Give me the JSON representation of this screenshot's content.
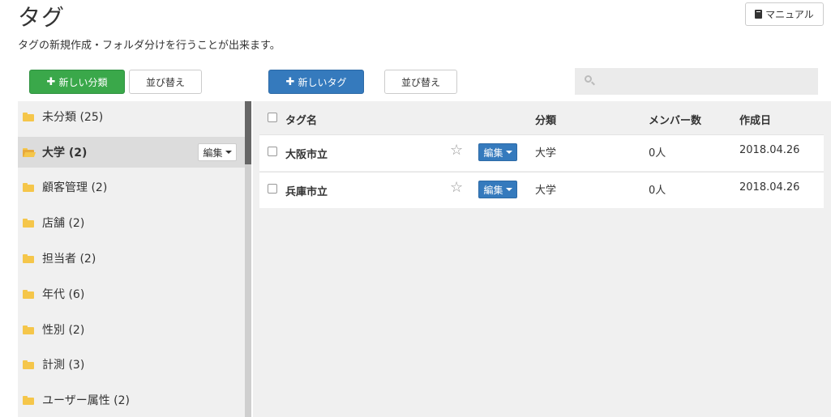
{
  "header": {
    "title": "タグ",
    "description": "タグの新規作成・フォルダ分けを行うことが出来ます。",
    "manual_label": "マニュアル"
  },
  "toolbar": {
    "new_category_label": "新しい分類",
    "sort_left_label": "並び替え",
    "new_tag_label": "新しいタグ",
    "sort_right_label": "並び替え"
  },
  "search": {
    "placeholder": ""
  },
  "sidebar": {
    "items": [
      {
        "label": "未分類 (25)",
        "active": false
      },
      {
        "label": "大学 (2)",
        "active": true
      },
      {
        "label": "顧客管理 (2)",
        "active": false
      },
      {
        "label": "店舗 (2)",
        "active": false
      },
      {
        "label": "担当者 (2)",
        "active": false
      },
      {
        "label": "年代 (6)",
        "active": false
      },
      {
        "label": "性別 (2)",
        "active": false
      },
      {
        "label": "計測 (3)",
        "active": false
      },
      {
        "label": "ユーザー属性 (2)",
        "active": false
      }
    ],
    "edit_label": "編集"
  },
  "table": {
    "columns": {
      "tag_name": "タグ名",
      "category": "分類",
      "members": "メンバー数",
      "created": "作成日"
    },
    "rows": [
      {
        "name": "大阪市立",
        "edit_label": "編集",
        "category": "大学",
        "members": "0人",
        "created": "2018.04.26"
      },
      {
        "name": "兵庫市立",
        "edit_label": "編集",
        "category": "大学",
        "members": "0人",
        "created": "2018.04.26"
      }
    ]
  },
  "colors": {
    "green": "#3aa84a",
    "blue": "#357abd",
    "folder": "#f5c64a"
  }
}
